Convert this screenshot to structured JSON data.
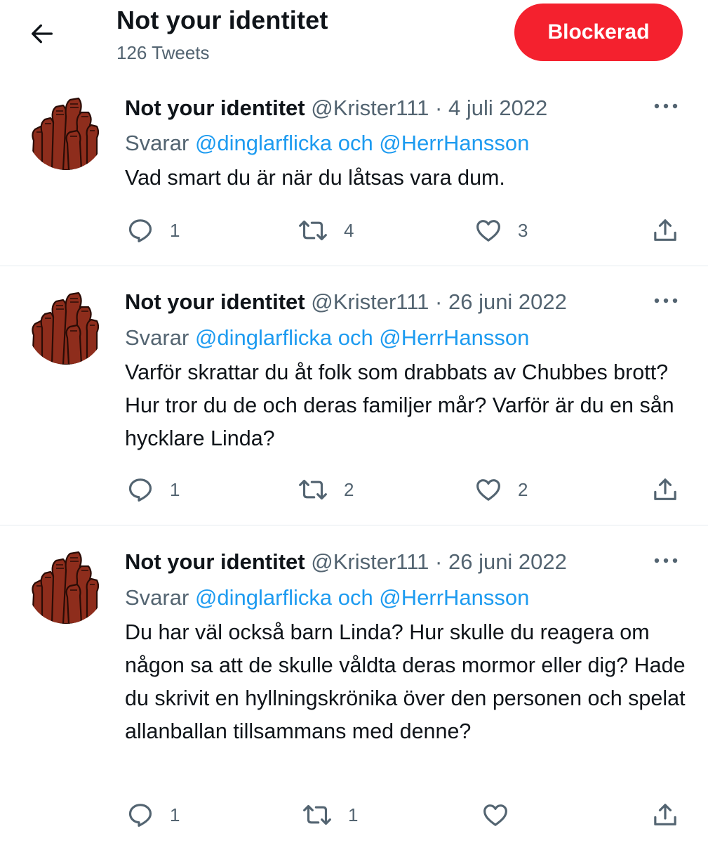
{
  "header": {
    "title": "Not your identitet",
    "subtitle": "126 Tweets",
    "block_label": "Blockerad"
  },
  "tweets": [
    {
      "name": "Not your identitet",
      "handle": "@Krister111",
      "sep": "·",
      "date": "4 juli 2022",
      "reply_prefix": "Svarar",
      "reply_mentions": "@dinglarflicka och @HerrHansson",
      "text": "Vad smart du är när du låtsas vara dum.",
      "replies": "1",
      "retweets": "4",
      "likes": "3"
    },
    {
      "name": "Not your identitet",
      "handle": "@Krister111",
      "sep": "·",
      "date": "26 juni 2022",
      "reply_prefix": "Svarar",
      "reply_mentions": "@dinglarflicka och @HerrHansson",
      "text": "Varför skrattar du åt folk som drabbats av Chubbes brott? Hur tror du de och deras familjer mår? Varför är du en sån hycklare Linda?",
      "replies": "1",
      "retweets": "2",
      "likes": "2"
    },
    {
      "name": "Not your identitet",
      "handle": "@Krister111",
      "sep": "·",
      "date": "26 juni 2022",
      "reply_prefix": "Svarar",
      "reply_mentions": "@dinglarflicka och @HerrHansson",
      "text": "Du har väl också barn Linda? Hur skulle du reagera om någon sa att de skulle våldta deras mormor eller dig? Hade du skrivit en hyllningskrönika över den personen och spelat allanballan tillsammans med denne?",
      "replies": "1",
      "retweets": "1",
      "likes": ""
    }
  ],
  "icons": {
    "back": "arrow-left-icon",
    "more": "more-horizontal-icon",
    "reply": "reply-bubble-icon",
    "retweet": "retweet-icon",
    "like": "heart-icon",
    "share": "share-icon",
    "avatar": "raised-fists-avatar"
  },
  "colors": {
    "accent": "#1d9bf0",
    "block_button": "#f4212e",
    "muted_text": "#536471",
    "avatar_bg": "#8b2a1a"
  }
}
